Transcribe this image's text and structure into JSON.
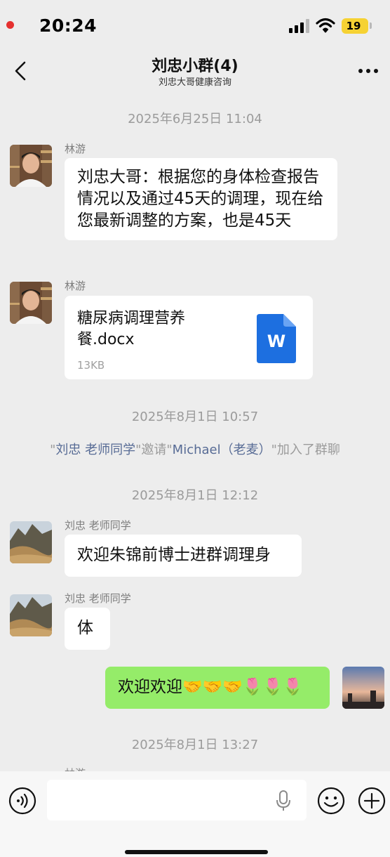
{
  "status_bar": {
    "time": "20:24",
    "battery": "19"
  },
  "header": {
    "title": "刘忠小群(4)",
    "subtitle": "刘忠大哥健康咨询"
  },
  "timestamps": [
    "2025年6月25日 11:04",
    "2025年8月1日 10:57",
    "2025年8月1日 12:12",
    "2025年8月1日 13:27"
  ],
  "system_message": {
    "q1": "\"",
    "inviter": "刘忠 老师同学",
    "mid": "\"邀请\"",
    "invitee": "Michael（老麦）",
    "end": "\"加入了群聊"
  },
  "messages": [
    {
      "sender": "林游",
      "text": "刘忠大哥：根据您的身体检查报告情况以及通过45天的调理，现在给您最新调整的方案，也是45天"
    },
    {
      "sender": "林游",
      "file_name": "糖尿病调理营养餐.docx",
      "file_size": "13KB",
      "file_icon_letter": "W"
    },
    {
      "sender": "刘忠 老师同学",
      "text": "欢迎朱锦前博士进群调理身"
    },
    {
      "sender": "刘忠 老师同学",
      "text": "体"
    },
    {
      "sender": "me",
      "text": "欢迎欢迎🤝🤝🤝🌷🌷🌷"
    }
  ],
  "peek_sender": "林游",
  "colors": {
    "bubble_self": "#95ec69",
    "link": "#576b95",
    "word_blue": "#1d6fe0"
  }
}
